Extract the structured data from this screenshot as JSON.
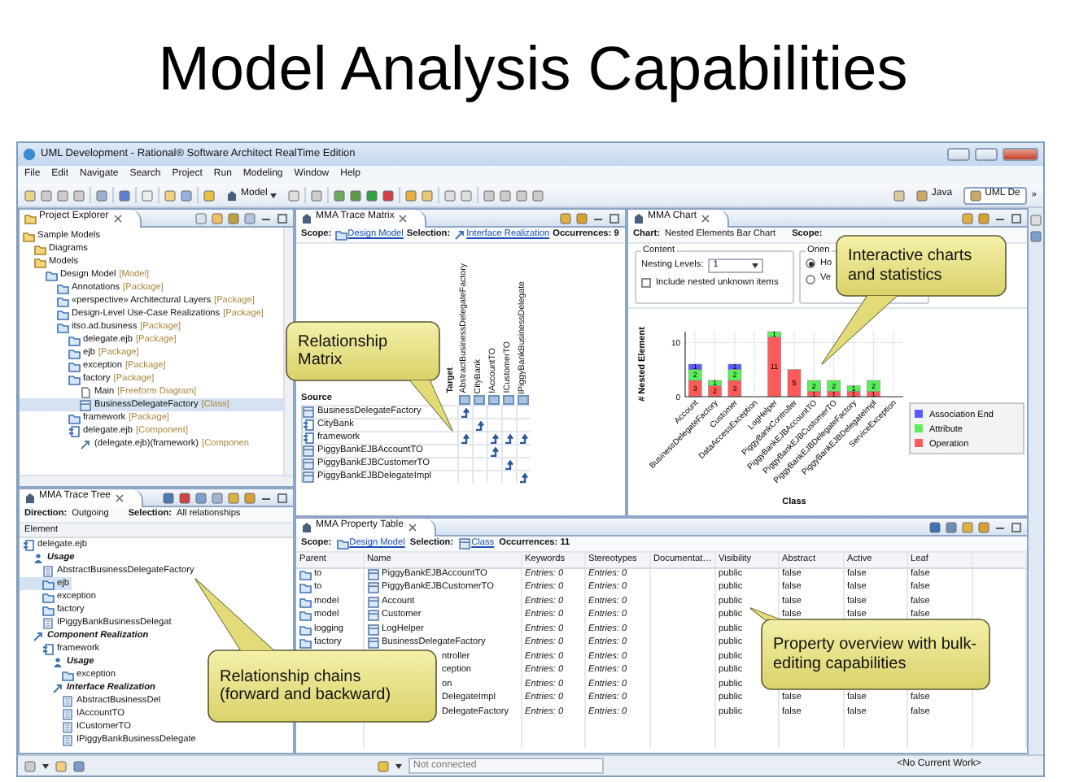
{
  "slide_title": "Model Analysis Capabilities",
  "window": {
    "title": "UML Development - Rational® Software Architect RealTime Edition"
  },
  "menu": [
    "File",
    "Edit",
    "Navigate",
    "Search",
    "Project",
    "Run",
    "Modeling",
    "Window",
    "Help"
  ],
  "toolbar": {
    "model_button": "Model",
    "perspectives": [
      {
        "label": "Java",
        "selected": false
      },
      {
        "label": "UML De",
        "selected": true
      }
    ],
    "more": "»"
  },
  "project_explorer": {
    "title": "Project Explorer",
    "tree": [
      {
        "name": "Sample Models",
        "kind": "project",
        "selected": false,
        "children": [
          {
            "name": "Diagrams",
            "kind": "project",
            "selected": false
          },
          {
            "name": "Models",
            "kind": "project",
            "selected": false,
            "children": [
              {
                "name": "Design Model",
                "type": "[Model]",
                "kind": "folder",
                "selected": false,
                "children": [
                  {
                    "name": "Annotations",
                    "type": "[Package]",
                    "kind": "folder",
                    "selected": false
                  },
                  {
                    "name": "«perspective» Architectural Layers",
                    "type": "[Package]",
                    "kind": "folder",
                    "selected": false
                  },
                  {
                    "name": "Design-Level Use-Case Realizations",
                    "type": "[Package]",
                    "kind": "folder",
                    "selected": false
                  },
                  {
                    "name": "itso.ad.business",
                    "type": "[Package]",
                    "kind": "folder",
                    "selected": false,
                    "children": [
                      {
                        "name": "delegate.ejb",
                        "type": "[Package]",
                        "kind": "folder",
                        "selected": false
                      },
                      {
                        "name": "ejb",
                        "type": "[Package]",
                        "kind": "folder",
                        "selected": false
                      },
                      {
                        "name": "exception",
                        "type": "[Package]",
                        "kind": "folder",
                        "selected": false
                      },
                      {
                        "name": "factory",
                        "type": "[Package]",
                        "kind": "folder",
                        "selected": false,
                        "children": [
                          {
                            "name": "Main",
                            "type": "[Freeform Diagram]",
                            "kind": "diagram",
                            "selected": false
                          },
                          {
                            "name": "BusinessDelegateFactory",
                            "type": "[Class]",
                            "kind": "class",
                            "selected": true
                          }
                        ]
                      },
                      {
                        "name": "framework",
                        "type": "[Package]",
                        "kind": "folder",
                        "selected": false
                      },
                      {
                        "name": "delegate.ejb",
                        "type": "[Component]",
                        "kind": "component",
                        "selected": false,
                        "children": [
                          {
                            "name": "(delegate.ejb)(framework)",
                            "type": "[Componen",
                            "kind": "link",
                            "selected": false
                          }
                        ]
                      }
                    ]
                  }
                ]
              }
            ]
          }
        ]
      }
    ]
  },
  "trace_tree": {
    "title": "MMA Trace Tree",
    "direction_label": "Direction:",
    "direction": "Outgoing",
    "selection_label": "Selection:",
    "selection": "All relationships",
    "column": "Element",
    "tree": [
      {
        "name": "delegate.ejb",
        "kind": "component",
        "selected": false,
        "children": [
          {
            "name": "Usage",
            "kind": "usage",
            "selected": false,
            "children": [
              {
                "name": "AbstractBusinessDelegateFactory",
                "kind": "interface",
                "selected": false
              },
              {
                "name": "ejb",
                "kind": "folder",
                "selected": true
              },
              {
                "name": "exception",
                "kind": "folder",
                "selected": false
              },
              {
                "name": "factory",
                "kind": "folder",
                "selected": false
              },
              {
                "name": "IPiggyBankBusinessDelegat",
                "kind": "interface",
                "selected": false
              }
            ]
          },
          {
            "name": "Component Realization",
            "kind": "realization",
            "selected": false,
            "children": [
              {
                "name": "framework",
                "kind": "component",
                "selected": false,
                "children": [
                  {
                    "name": "Usage",
                    "kind": "usage",
                    "selected": false,
                    "children": [
                      {
                        "name": "exception",
                        "kind": "folder",
                        "selected": false
                      }
                    ]
                  },
                  {
                    "name": "Interface Realization",
                    "kind": "realization",
                    "selected": false,
                    "children": [
                      {
                        "name": "AbstractBusinessDel",
                        "kind": "interface",
                        "selected": false
                      },
                      {
                        "name": "IAccountTO",
                        "kind": "interface",
                        "selected": false
                      },
                      {
                        "name": "ICustomerTO",
                        "kind": "interface",
                        "selected": false
                      },
                      {
                        "name": "IPiggyBankBusinessDelegate",
                        "kind": "interface",
                        "selected": false
                      }
                    ]
                  }
                ]
              }
            ]
          }
        ]
      }
    ]
  },
  "trace_matrix": {
    "title": "MMA Trace Matrix",
    "scope_label": "Scope:",
    "scope": "Design Model",
    "selection_label": "Selection:",
    "selection": "Interface Realization",
    "occurrences": "Occurrences: 9",
    "target_label": "Target",
    "source_label": "Source",
    "columns": [
      "AbstractBusinessDelegateFactory",
      "CityBank",
      "IAccountTO",
      "ICustomerTO",
      "IPiggyBankBusinessDelegate"
    ],
    "rows": [
      {
        "name": "BusinessDelegateFactory",
        "kind": "class",
        "links": [
          true,
          false,
          false,
          false,
          false
        ]
      },
      {
        "name": "CityBank",
        "kind": "component",
        "links": [
          false,
          true,
          false,
          false,
          false
        ]
      },
      {
        "name": "framework",
        "kind": "component",
        "links": [
          true,
          false,
          true,
          true,
          true
        ]
      },
      {
        "name": "PiggyBankEJBAccountTO",
        "kind": "class",
        "links": [
          false,
          false,
          true,
          false,
          false
        ]
      },
      {
        "name": "PiggyBankEJBCustomerTO",
        "kind": "class",
        "links": [
          false,
          false,
          false,
          true,
          false
        ]
      },
      {
        "name": "PiggyBankEJBDelegateImpl",
        "kind": "class",
        "links": [
          false,
          false,
          false,
          false,
          true
        ]
      }
    ]
  },
  "chart_panel": {
    "title": "MMA Chart",
    "chart_label": "Chart:",
    "chart_name": "Nested Elements Bar Chart",
    "scope_label": "Scope:",
    "content_group": "Content",
    "nesting_label": "Nesting Levels:",
    "nesting_value": "1",
    "include_nested": {
      "label": "Include nested unknown items",
      "checked": false
    },
    "orientation_group": "Orien",
    "orientations": [
      {
        "label": "Ho",
        "selected": true
      },
      {
        "label": "Ve",
        "selected": false
      }
    ],
    "chart_data": {
      "type": "bar",
      "xlabel": "Class",
      "ylabel": "# Nested Element",
      "categories": [
        "Account",
        "BusinessDelegateFactory",
        "Customer",
        "DataAccessException",
        "LogHelper",
        "PiggyBankController",
        "PiggyBankEJBAccountTO",
        "PiggyBankEJBCustomerTO",
        "PiggyBankEJBDelegateFactory",
        "PiggyBankEJBDelegateImpl",
        "ServiceException"
      ],
      "series": [
        {
          "name": "Operation",
          "color": "#ff5a5a",
          "values": [
            3,
            2,
            3,
            0,
            11,
            5,
            1,
            1,
            1,
            1,
            0
          ]
        },
        {
          "name": "Attribute",
          "color": "#5aef5a",
          "values": [
            2,
            1,
            2,
            0,
            1,
            0,
            2,
            2,
            1,
            2,
            0
          ]
        },
        {
          "name": "Association End",
          "color": "#5a5aff",
          "values": [
            1,
            0,
            1,
            0,
            0,
            0,
            0,
            0,
            0,
            0,
            0
          ]
        }
      ],
      "ylim": [
        0,
        12
      ],
      "yticks": [
        0,
        10
      ],
      "stacked": true,
      "grid": true,
      "legend": "right",
      "value_labels": [
        [
          "3",
          "2",
          "3",
          null,
          "11",
          "5",
          "1",
          "1",
          "1",
          "1",
          null
        ],
        [
          "2",
          "1",
          "2",
          null,
          "1",
          null,
          "2",
          "2",
          "1",
          "2",
          null
        ],
        [
          "1",
          null,
          "1",
          null,
          null,
          null,
          null,
          null,
          null,
          null,
          null
        ]
      ]
    }
  },
  "property_table": {
    "title": "MMA Property Table",
    "scope_label": "Scope:",
    "scope": "Design Model",
    "selection_label": "Selection:",
    "selection": "Class",
    "occurrences": "Occurrences: 11",
    "columns": [
      "Parent",
      "Name",
      "Keywords",
      "Stereotypes",
      "Documentat…",
      "Visibility",
      "Abstract",
      "Active",
      "Leaf"
    ],
    "rows": [
      {
        "parent": "to",
        "name": "PiggyBankEJBAccountTO",
        "keywords": "Entries: 0",
        "stereotypes": "Entries: 0",
        "visibility": "public",
        "abstract": "false",
        "active": "false",
        "leaf": "false"
      },
      {
        "parent": "to",
        "name": "PiggyBankEJBCustomerTO",
        "keywords": "Entries: 0",
        "stereotypes": "Entries: 0",
        "visibility": "public",
        "abstract": "false",
        "active": "false",
        "leaf": "false"
      },
      {
        "parent": "model",
        "name": "Account",
        "keywords": "Entries: 0",
        "stereotypes": "Entries: 0",
        "visibility": "public",
        "abstract": "false",
        "active": "false",
        "leaf": "false"
      },
      {
        "parent": "model",
        "name": "Customer",
        "keywords": "Entries: 0",
        "stereotypes": "Entries: 0",
        "visibility": "public",
        "abstract": "false",
        "active": "false",
        "leaf": "false"
      },
      {
        "parent": "logging",
        "name": "LogHelper",
        "keywords": "Entries: 0",
        "stereotypes": "Entries: 0",
        "visibility": "public"
      },
      {
        "parent": "factory",
        "name": "BusinessDelegateFactory",
        "keywords": "Entries: 0",
        "stereotypes": "Entries: 0",
        "visibility": "public"
      },
      {
        "name": "ntroller",
        "keywords": "Entries: 0",
        "stereotypes": "Entries: 0",
        "visibility": "public"
      },
      {
        "name": "ception",
        "keywords": "Entries: 0",
        "stereotypes": "Entries: 0",
        "visibility": "public"
      },
      {
        "name": "on",
        "keywords": "Entries: 0",
        "stereotypes": "Entries: 0",
        "visibility": "public"
      },
      {
        "name": "DelegateImpl",
        "keywords": "Entries: 0",
        "stereotypes": "Entries: 0",
        "visibility": "public",
        "abstract": "false",
        "active": "false",
        "leaf": "false"
      },
      {
        "name": "DelegateFactory",
        "keywords": "Entries: 0",
        "stereotypes": "Entries: 0",
        "visibility": "public",
        "abstract": "false",
        "active": "false",
        "leaf": "false"
      }
    ]
  },
  "status_bar": {
    "connection": "Not connected",
    "work": "<No Current Work>"
  },
  "callouts": [
    {
      "text": "Relationship Matrix"
    },
    {
      "text": "Interactive charts and statistics"
    },
    {
      "text": "Relationship chains (forward and backward)"
    },
    {
      "text": "Property overview with bulk-editing capabilities"
    }
  ]
}
